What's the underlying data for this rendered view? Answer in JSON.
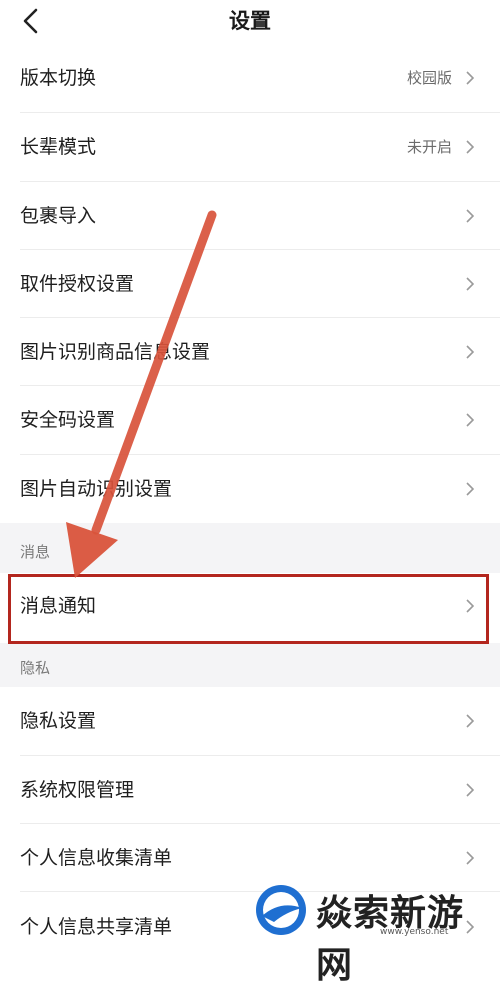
{
  "header": {
    "title": "设置",
    "back_icon": "chevron-left-icon"
  },
  "rows": [
    {
      "label": "版本切换",
      "value": "校园版"
    },
    {
      "label": "长辈模式",
      "value": "未开启"
    },
    {
      "label": "包裹导入",
      "value": ""
    },
    {
      "label": "取件授权设置",
      "value": ""
    },
    {
      "label": "图片识别商品信息设置",
      "value": ""
    },
    {
      "label": "安全码设置",
      "value": ""
    },
    {
      "label": "图片自动识别设置",
      "value": ""
    }
  ],
  "sections": {
    "message": {
      "title": "消息",
      "rows": [
        {
          "label": "消息通知"
        }
      ]
    },
    "privacy": {
      "title": "隐私",
      "rows": [
        {
          "label": "隐私设置"
        },
        {
          "label": "系统权限管理"
        },
        {
          "label": "个人信息收集清单"
        },
        {
          "label": "个人信息共享清单"
        }
      ]
    }
  },
  "annotation": {
    "color": "#b3261e",
    "target": "消息通知"
  },
  "watermark": {
    "text": "焱索新游网",
    "url": "www.yenso.net"
  },
  "colors": {
    "background": "#ffffff",
    "section_background": "#f4f4f6",
    "chevron": "#9a9a9a"
  }
}
